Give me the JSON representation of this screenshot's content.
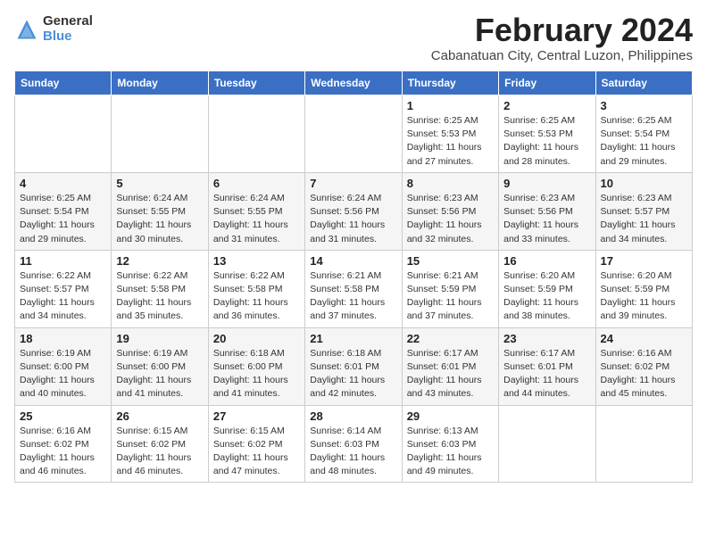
{
  "logo": {
    "general": "General",
    "blue": "Blue"
  },
  "title": "February 2024",
  "subtitle": "Cabanatuan City, Central Luzon, Philippines",
  "days_of_week": [
    "Sunday",
    "Monday",
    "Tuesday",
    "Wednesday",
    "Thursday",
    "Friday",
    "Saturday"
  ],
  "weeks": [
    [
      {
        "day": "",
        "info": ""
      },
      {
        "day": "",
        "info": ""
      },
      {
        "day": "",
        "info": ""
      },
      {
        "day": "",
        "info": ""
      },
      {
        "day": "1",
        "info": "Sunrise: 6:25 AM\nSunset: 5:53 PM\nDaylight: 11 hours and 27 minutes."
      },
      {
        "day": "2",
        "info": "Sunrise: 6:25 AM\nSunset: 5:53 PM\nDaylight: 11 hours and 28 minutes."
      },
      {
        "day": "3",
        "info": "Sunrise: 6:25 AM\nSunset: 5:54 PM\nDaylight: 11 hours and 29 minutes."
      }
    ],
    [
      {
        "day": "4",
        "info": "Sunrise: 6:25 AM\nSunset: 5:54 PM\nDaylight: 11 hours and 29 minutes."
      },
      {
        "day": "5",
        "info": "Sunrise: 6:24 AM\nSunset: 5:55 PM\nDaylight: 11 hours and 30 minutes."
      },
      {
        "day": "6",
        "info": "Sunrise: 6:24 AM\nSunset: 5:55 PM\nDaylight: 11 hours and 31 minutes."
      },
      {
        "day": "7",
        "info": "Sunrise: 6:24 AM\nSunset: 5:56 PM\nDaylight: 11 hours and 31 minutes."
      },
      {
        "day": "8",
        "info": "Sunrise: 6:23 AM\nSunset: 5:56 PM\nDaylight: 11 hours and 32 minutes."
      },
      {
        "day": "9",
        "info": "Sunrise: 6:23 AM\nSunset: 5:56 PM\nDaylight: 11 hours and 33 minutes."
      },
      {
        "day": "10",
        "info": "Sunrise: 6:23 AM\nSunset: 5:57 PM\nDaylight: 11 hours and 34 minutes."
      }
    ],
    [
      {
        "day": "11",
        "info": "Sunrise: 6:22 AM\nSunset: 5:57 PM\nDaylight: 11 hours and 34 minutes."
      },
      {
        "day": "12",
        "info": "Sunrise: 6:22 AM\nSunset: 5:58 PM\nDaylight: 11 hours and 35 minutes."
      },
      {
        "day": "13",
        "info": "Sunrise: 6:22 AM\nSunset: 5:58 PM\nDaylight: 11 hours and 36 minutes."
      },
      {
        "day": "14",
        "info": "Sunrise: 6:21 AM\nSunset: 5:58 PM\nDaylight: 11 hours and 37 minutes."
      },
      {
        "day": "15",
        "info": "Sunrise: 6:21 AM\nSunset: 5:59 PM\nDaylight: 11 hours and 37 minutes."
      },
      {
        "day": "16",
        "info": "Sunrise: 6:20 AM\nSunset: 5:59 PM\nDaylight: 11 hours and 38 minutes."
      },
      {
        "day": "17",
        "info": "Sunrise: 6:20 AM\nSunset: 5:59 PM\nDaylight: 11 hours and 39 minutes."
      }
    ],
    [
      {
        "day": "18",
        "info": "Sunrise: 6:19 AM\nSunset: 6:00 PM\nDaylight: 11 hours and 40 minutes."
      },
      {
        "day": "19",
        "info": "Sunrise: 6:19 AM\nSunset: 6:00 PM\nDaylight: 11 hours and 41 minutes."
      },
      {
        "day": "20",
        "info": "Sunrise: 6:18 AM\nSunset: 6:00 PM\nDaylight: 11 hours and 41 minutes."
      },
      {
        "day": "21",
        "info": "Sunrise: 6:18 AM\nSunset: 6:01 PM\nDaylight: 11 hours and 42 minutes."
      },
      {
        "day": "22",
        "info": "Sunrise: 6:17 AM\nSunset: 6:01 PM\nDaylight: 11 hours and 43 minutes."
      },
      {
        "day": "23",
        "info": "Sunrise: 6:17 AM\nSunset: 6:01 PM\nDaylight: 11 hours and 44 minutes."
      },
      {
        "day": "24",
        "info": "Sunrise: 6:16 AM\nSunset: 6:02 PM\nDaylight: 11 hours and 45 minutes."
      }
    ],
    [
      {
        "day": "25",
        "info": "Sunrise: 6:16 AM\nSunset: 6:02 PM\nDaylight: 11 hours and 46 minutes."
      },
      {
        "day": "26",
        "info": "Sunrise: 6:15 AM\nSunset: 6:02 PM\nDaylight: 11 hours and 46 minutes."
      },
      {
        "day": "27",
        "info": "Sunrise: 6:15 AM\nSunset: 6:02 PM\nDaylight: 11 hours and 47 minutes."
      },
      {
        "day": "28",
        "info": "Sunrise: 6:14 AM\nSunset: 6:03 PM\nDaylight: 11 hours and 48 minutes."
      },
      {
        "day": "29",
        "info": "Sunrise: 6:13 AM\nSunset: 6:03 PM\nDaylight: 11 hours and 49 minutes."
      },
      {
        "day": "",
        "info": ""
      },
      {
        "day": "",
        "info": ""
      }
    ]
  ]
}
